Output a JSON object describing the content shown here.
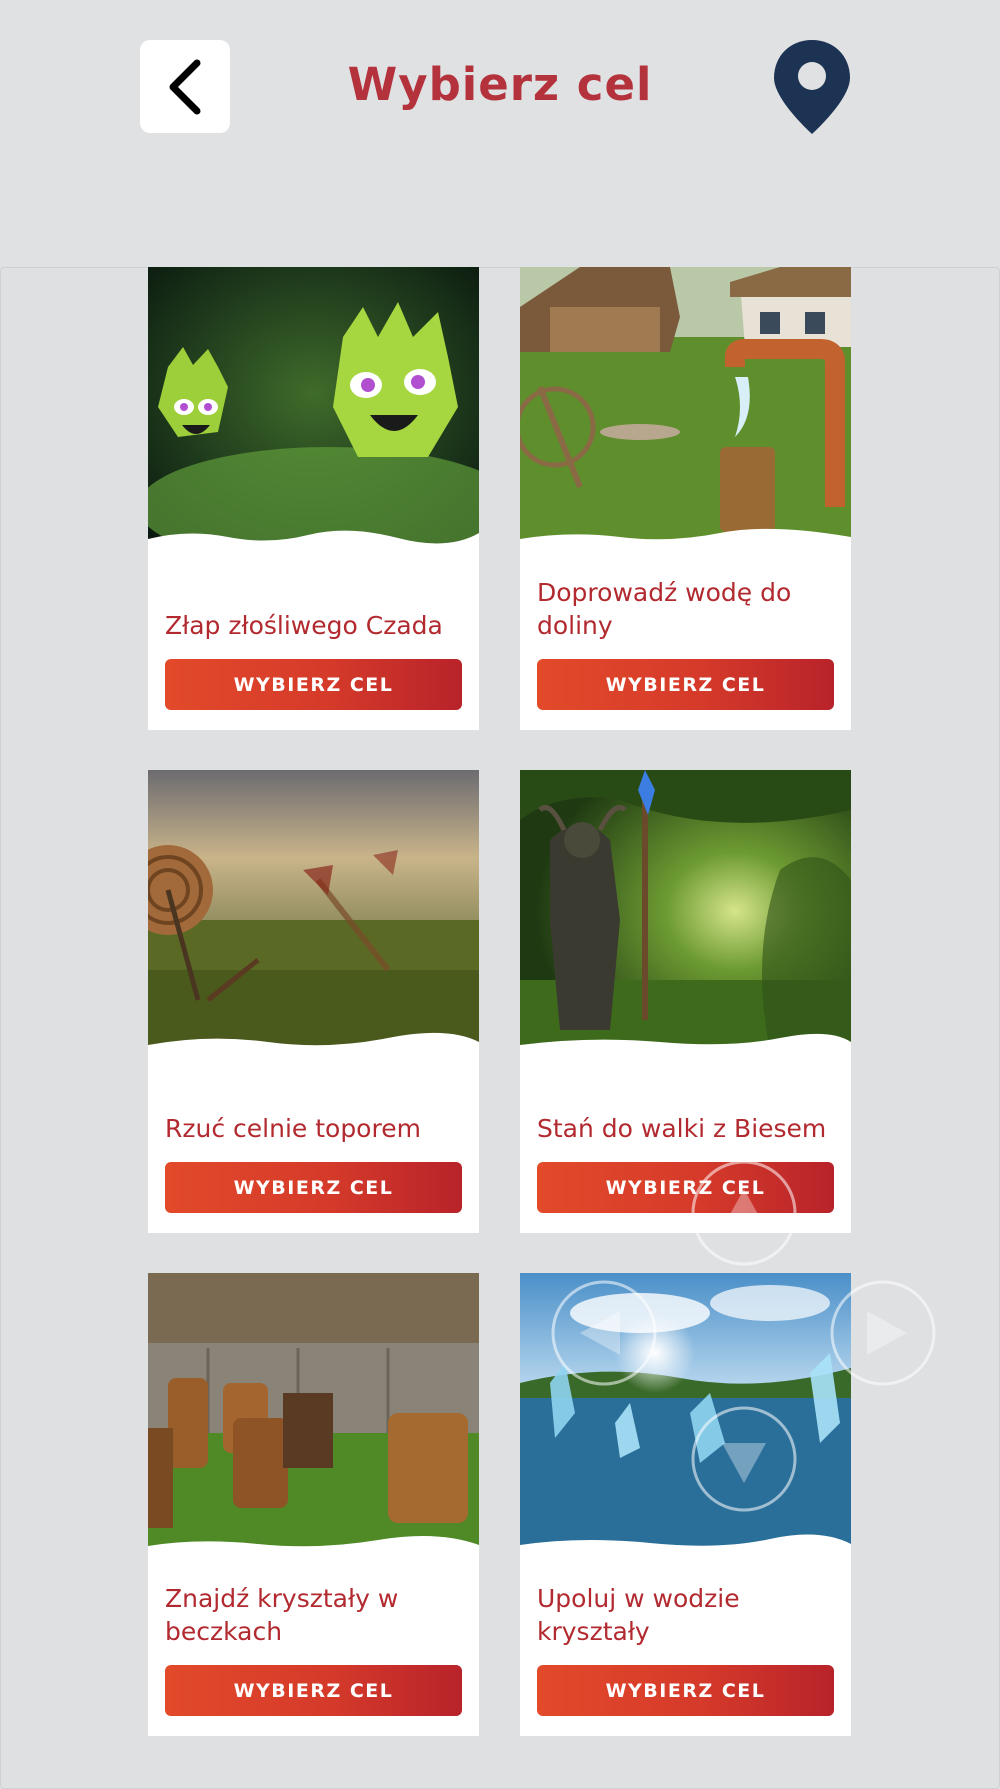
{
  "header": {
    "title": "Wybierz cel",
    "back_icon": "chevron-left-icon",
    "location_icon": "map-pin-icon"
  },
  "colors": {
    "title": "#b4323c",
    "button_start": "#e24a2a",
    "button_end": "#b8232a",
    "pin": "#1c3354",
    "background": "#e0e1e3"
  },
  "cards": [
    {
      "title": "Złap złośliwego Czada",
      "button": "WYBIERZ CEL",
      "image": "green-ghost-monsters"
    },
    {
      "title": "Doprowadź wodę do doliny",
      "button": "WYBIERZ CEL",
      "image": "village-water-pipe"
    },
    {
      "title": "Rzuć celnie toporem",
      "button": "WYBIERZ CEL",
      "image": "axe-throwing-target"
    },
    {
      "title": "Stań do walki z Biesem",
      "button": "WYBIERZ CEL",
      "image": "forest-demon-bies"
    },
    {
      "title": "Znajdź kryształy w beczkach",
      "button": "WYBIERZ CEL",
      "image": "barrels-by-hut"
    },
    {
      "title": "Upoluj w wodzie kryształy",
      "button": "WYBIERZ CEL",
      "image": "lake-crystals"
    }
  ],
  "overlay_controls": [
    "arrow-up-icon",
    "arrow-left-icon",
    "arrow-right-icon",
    "arrow-down-icon"
  ]
}
